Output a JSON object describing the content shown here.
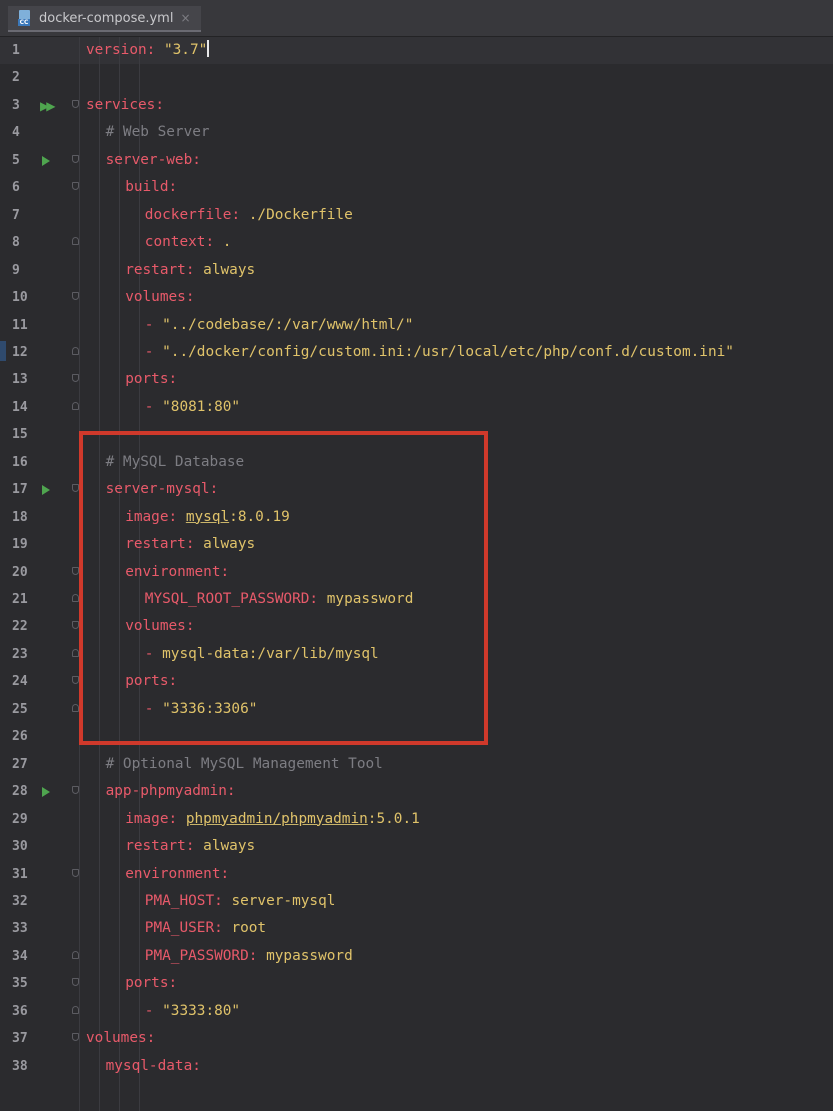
{
  "tab": {
    "filename": "docker-compose.yml",
    "icon_badge": "CC",
    "close_glyph": "×"
  },
  "lines": [
    {
      "n": "1",
      "indent": 0,
      "parts": [
        {
          "t": "version",
          "c": "k"
        },
        {
          "t": ": ",
          "c": "p"
        },
        {
          "t": "\"3.7\"",
          "c": "s"
        }
      ],
      "cursor": true
    },
    {
      "n": "2",
      "indent": 0,
      "parts": []
    },
    {
      "n": "3",
      "indent": 0,
      "gutter": "run-all",
      "fold": "start",
      "parts": [
        {
          "t": "services",
          "c": "k"
        },
        {
          "t": ":",
          "c": "p"
        }
      ]
    },
    {
      "n": "4",
      "indent": 1,
      "parts": [
        {
          "t": "# Web Server",
          "c": "c"
        }
      ]
    },
    {
      "n": "5",
      "indent": 1,
      "gutter": "run",
      "fold": "start",
      "parts": [
        {
          "t": "server-web",
          "c": "k"
        },
        {
          "t": ":",
          "c": "p"
        }
      ]
    },
    {
      "n": "6",
      "indent": 2,
      "fold": "start",
      "parts": [
        {
          "t": "build",
          "c": "k"
        },
        {
          "t": ":",
          "c": "p"
        }
      ]
    },
    {
      "n": "7",
      "indent": 3,
      "parts": [
        {
          "t": "dockerfile",
          "c": "k"
        },
        {
          "t": ": ",
          "c": "p"
        },
        {
          "t": "./Dockerfile",
          "c": "v"
        }
      ]
    },
    {
      "n": "8",
      "indent": 3,
      "fold": "end",
      "parts": [
        {
          "t": "context",
          "c": "k"
        },
        {
          "t": ": ",
          "c": "p"
        },
        {
          "t": ".",
          "c": "v"
        }
      ]
    },
    {
      "n": "9",
      "indent": 2,
      "parts": [
        {
          "t": "restart",
          "c": "k"
        },
        {
          "t": ": ",
          "c": "p"
        },
        {
          "t": "always",
          "c": "v"
        }
      ]
    },
    {
      "n": "10",
      "indent": 2,
      "fold": "start",
      "parts": [
        {
          "t": "volumes",
          "c": "k"
        },
        {
          "t": ":",
          "c": "p"
        }
      ]
    },
    {
      "n": "11",
      "indent": 3,
      "parts": [
        {
          "t": "- ",
          "c": "p"
        },
        {
          "t": "\"../codebase/:/var/www/html/\"",
          "c": "s"
        }
      ]
    },
    {
      "n": "12",
      "indent": 3,
      "fold": "end",
      "parts": [
        {
          "t": "- ",
          "c": "p"
        },
        {
          "t": "\"../docker/config/custom.ini:/usr/local/etc/php/conf.d/custom.ini\"",
          "c": "s"
        }
      ]
    },
    {
      "n": "13",
      "indent": 2,
      "fold": "start",
      "parts": [
        {
          "t": "ports",
          "c": "k"
        },
        {
          "t": ":",
          "c": "p"
        }
      ]
    },
    {
      "n": "14",
      "indent": 3,
      "fold": "end",
      "parts": [
        {
          "t": "- ",
          "c": "p"
        },
        {
          "t": "\"8081:80\"",
          "c": "s"
        }
      ]
    },
    {
      "n": "15",
      "indent": 0,
      "parts": []
    },
    {
      "n": "16",
      "indent": 1,
      "parts": [
        {
          "t": "# MySQL Database",
          "c": "c"
        }
      ]
    },
    {
      "n": "17",
      "indent": 1,
      "gutter": "run",
      "fold": "start",
      "parts": [
        {
          "t": "server-mysql",
          "c": "k"
        },
        {
          "t": ":",
          "c": "p"
        }
      ]
    },
    {
      "n": "18",
      "indent": 2,
      "parts": [
        {
          "t": "image",
          "c": "k"
        },
        {
          "t": ": ",
          "c": "p"
        },
        {
          "t": "mysql",
          "c": "v",
          "u": true
        },
        {
          "t": ":8.0.19",
          "c": "v"
        }
      ]
    },
    {
      "n": "19",
      "indent": 2,
      "parts": [
        {
          "t": "restart",
          "c": "k"
        },
        {
          "t": ": ",
          "c": "p"
        },
        {
          "t": "always",
          "c": "v"
        }
      ]
    },
    {
      "n": "20",
      "indent": 2,
      "fold": "start",
      "parts": [
        {
          "t": "environment",
          "c": "k"
        },
        {
          "t": ":",
          "c": "p"
        }
      ]
    },
    {
      "n": "21",
      "indent": 3,
      "fold": "end",
      "parts": [
        {
          "t": "MYSQL_ROOT_PASSWORD",
          "c": "k"
        },
        {
          "t": ": ",
          "c": "p"
        },
        {
          "t": "mypassword",
          "c": "v"
        }
      ]
    },
    {
      "n": "22",
      "indent": 2,
      "fold": "start",
      "parts": [
        {
          "t": "volumes",
          "c": "k"
        },
        {
          "t": ":",
          "c": "p"
        }
      ]
    },
    {
      "n": "23",
      "indent": 3,
      "fold": "end",
      "parts": [
        {
          "t": "- ",
          "c": "p"
        },
        {
          "t": "mysql-data:/var/lib/mysql",
          "c": "v"
        }
      ]
    },
    {
      "n": "24",
      "indent": 2,
      "fold": "start",
      "parts": [
        {
          "t": "ports",
          "c": "k"
        },
        {
          "t": ":",
          "c": "p"
        }
      ]
    },
    {
      "n": "25",
      "indent": 3,
      "fold": "end",
      "parts": [
        {
          "t": "- ",
          "c": "p"
        },
        {
          "t": "\"3336:3306\"",
          "c": "s"
        }
      ]
    },
    {
      "n": "26",
      "indent": 0,
      "parts": []
    },
    {
      "n": "27",
      "indent": 1,
      "parts": [
        {
          "t": "# Optional MySQL Management Tool",
          "c": "c"
        }
      ]
    },
    {
      "n": "28",
      "indent": 1,
      "gutter": "run",
      "fold": "start",
      "parts": [
        {
          "t": "app-phpmyadmin",
          "c": "k"
        },
        {
          "t": ":",
          "c": "p"
        }
      ]
    },
    {
      "n": "29",
      "indent": 2,
      "parts": [
        {
          "t": "image",
          "c": "k"
        },
        {
          "t": ": ",
          "c": "p"
        },
        {
          "t": "phpmyadmin/phpmyadmin",
          "c": "v",
          "u": true
        },
        {
          "t": ":5.0.1",
          "c": "v"
        }
      ]
    },
    {
      "n": "30",
      "indent": 2,
      "parts": [
        {
          "t": "restart",
          "c": "k"
        },
        {
          "t": ": ",
          "c": "p"
        },
        {
          "t": "always",
          "c": "v"
        }
      ]
    },
    {
      "n": "31",
      "indent": 2,
      "fold": "start",
      "parts": [
        {
          "t": "environment",
          "c": "k"
        },
        {
          "t": ":",
          "c": "p"
        }
      ]
    },
    {
      "n": "32",
      "indent": 3,
      "parts": [
        {
          "t": "PMA_HOST",
          "c": "k"
        },
        {
          "t": ": ",
          "c": "p"
        },
        {
          "t": "server-mysql",
          "c": "v"
        }
      ]
    },
    {
      "n": "33",
      "indent": 3,
      "parts": [
        {
          "t": "PMA_USER",
          "c": "k"
        },
        {
          "t": ": ",
          "c": "p"
        },
        {
          "t": "root",
          "c": "v"
        }
      ]
    },
    {
      "n": "34",
      "indent": 3,
      "fold": "end",
      "parts": [
        {
          "t": "PMA_PASSWORD",
          "c": "k"
        },
        {
          "t": ": ",
          "c": "p"
        },
        {
          "t": "mypassword",
          "c": "v"
        }
      ]
    },
    {
      "n": "35",
      "indent": 2,
      "fold": "start",
      "parts": [
        {
          "t": "ports",
          "c": "k"
        },
        {
          "t": ":",
          "c": "p"
        }
      ]
    },
    {
      "n": "36",
      "indent": 3,
      "fold": "end",
      "parts": [
        {
          "t": "- ",
          "c": "p"
        },
        {
          "t": "\"3333:80\"",
          "c": "s"
        }
      ]
    },
    {
      "n": "37",
      "indent": 0,
      "fold": "start",
      "parts": [
        {
          "t": "volumes",
          "c": "k"
        },
        {
          "t": ":",
          "c": "p"
        }
      ]
    },
    {
      "n": "38",
      "indent": 1,
      "parts": [
        {
          "t": "mysql-data",
          "c": "k"
        },
        {
          "t": ":",
          "c": "p"
        }
      ]
    }
  ],
  "colors": {
    "background": "#2b2b2e",
    "key": "#e85a6a",
    "string": "#e0c36a",
    "comment": "#7d7d83",
    "run_icon": "#4fa54f",
    "highlight_box": "#d0392b"
  },
  "highlight": {
    "label": "highlighted-mysql-service-block",
    "from_line": "16",
    "to_line": "25"
  }
}
